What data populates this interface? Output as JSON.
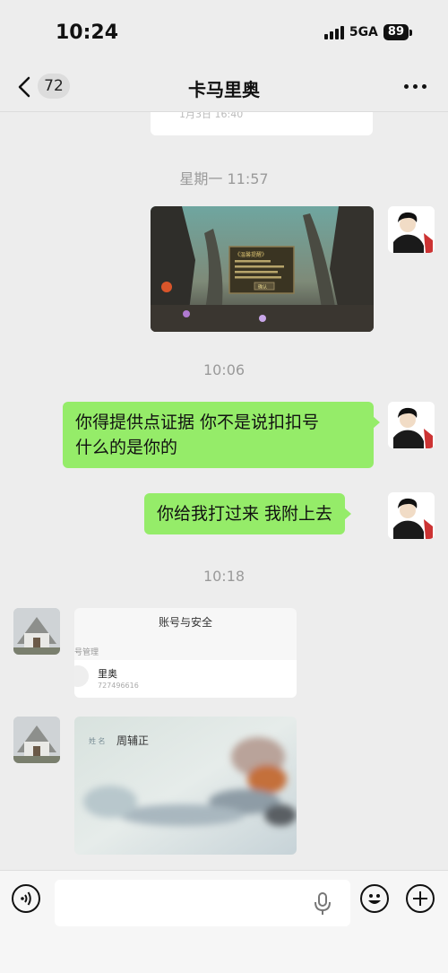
{
  "status": {
    "time": "10:24",
    "network": "5GA",
    "battery": "89"
  },
  "nav": {
    "back_count": "72",
    "title": "卡马里奥"
  },
  "messages": {
    "prev_card_time": "1月3日 16:40",
    "time1": "星期一 11:57",
    "time2": "10:06",
    "msg1_line1": "你得提供点证据   你不是说扣扣号",
    "msg1_line2": "什么的是你的",
    "msg2": "你给我打过来   我附上去",
    "time3": "10:18",
    "screenshot_title": "账号与安全",
    "screenshot_section": "号管理",
    "screenshot_name": "里奥",
    "screenshot_number": "727496616",
    "id_label": "姓 名",
    "id_name": "周辅正"
  },
  "game_dialog": {
    "title": "《温馨提醒》",
    "button": "确认"
  },
  "colors": {
    "bubble": "#95ec69",
    "background": "#ededed"
  }
}
